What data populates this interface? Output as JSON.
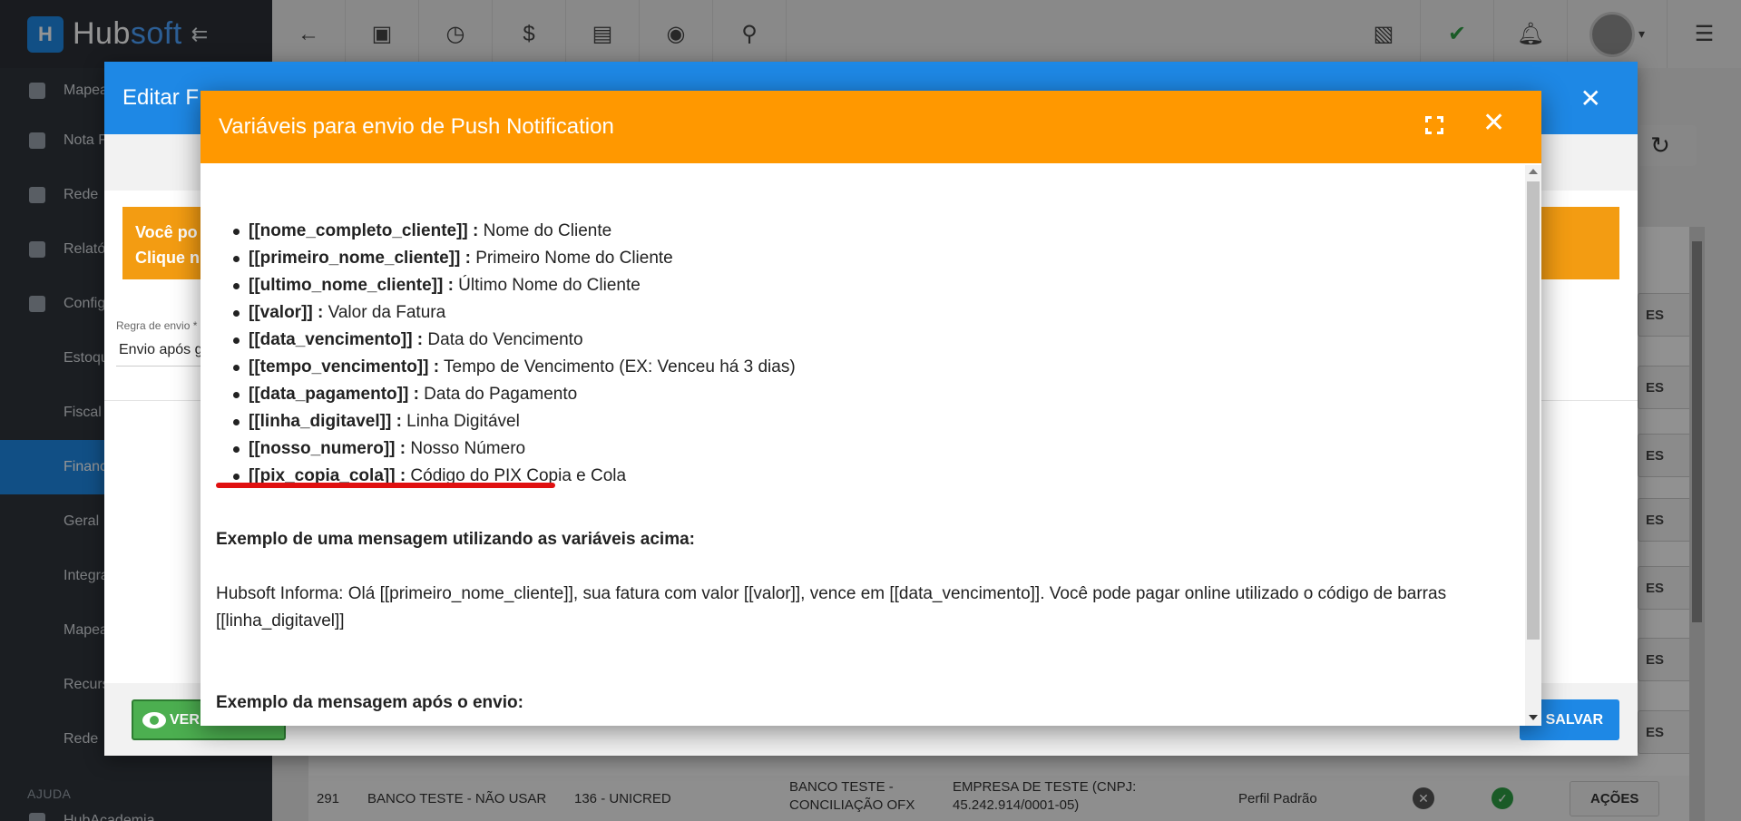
{
  "sidebar": {
    "logo_text_a": "Hub",
    "logo_text_b": "soft",
    "items": [
      {
        "label": "Mapea"
      },
      {
        "label": "Nota F"
      },
      {
        "label": "Rede"
      },
      {
        "label": "Relató"
      },
      {
        "label": "Config"
      }
    ],
    "sub_items": [
      {
        "label": "Estoqu"
      },
      {
        "label": "Fiscal"
      },
      {
        "label": "Financ"
      },
      {
        "label": "Geral"
      },
      {
        "label": "Integra"
      },
      {
        "label": "Mapea"
      },
      {
        "label": "Recurs"
      },
      {
        "label": "Rede"
      }
    ],
    "section_label": "AJUDA",
    "footer_item": "HubAcademia"
  },
  "background_table": {
    "row": {
      "id": "291",
      "name": "BANCO TESTE - NÃO USAR",
      "bank": "136 - UNICRED",
      "account": "BANCO TESTE - CONCILIAÇÃO OFX",
      "company": "EMPRESA DE TESTE (CNPJ: 45.242.914/0001-05)",
      "profile": "Perfil Padrão",
      "action": "AÇÕES"
    },
    "side_action_fragment": "ES"
  },
  "modal_edit": {
    "title": "Editar Forma de Cobrança",
    "title_visible": "Editar F",
    "warning_line1": "Você po",
    "warning_line2": "Clique n",
    "field_label": "Regra de envio *",
    "field_value": "Envio após g",
    "ver_button": "VER",
    "salvar_button": "SALVAR"
  },
  "modal_push": {
    "title": "Variáveis para envio de Push Notification",
    "variables": [
      {
        "key": "[[nome_completo_cliente]] :",
        "desc": " Nome do Cliente"
      },
      {
        "key": "[[primeiro_nome_cliente]] :",
        "desc": " Primeiro Nome do Cliente"
      },
      {
        "key": "[[ultimo_nome_cliente]] :",
        "desc": " Último Nome do Cliente"
      },
      {
        "key": "[[valor]] :",
        "desc": " Valor da Fatura"
      },
      {
        "key": "[[data_vencimento]] :",
        "desc": " Data do Vencimento"
      },
      {
        "key": "[[tempo_vencimento]] :",
        "desc": " Tempo de Vencimento (EX: Venceu há 3 dias)"
      },
      {
        "key": "[[data_pagamento]] :",
        "desc": " Data do Pagamento"
      },
      {
        "key": "[[linha_digitavel]] :",
        "desc": " Linha Digitável"
      },
      {
        "key": "[[nosso_numero]] :",
        "desc": " Nosso Número"
      },
      {
        "key": "[[pix_copia_cola]] :",
        "desc": " Código do PIX Copia e Cola"
      }
    ],
    "example_title": "Exemplo de uma mensagem utilizando as variáveis acima:",
    "example_text": "Hubsoft Informa: Olá [[primeiro_nome_cliente]], sua fatura com valor [[valor]], vence em [[data_vencimento]]. Você pode pagar online utilizado o código de barras [[linha_digitavel]]",
    "after_title": "Exemplo da mensagem após o envio:"
  },
  "colors": {
    "push_header": "#ff9800",
    "edit_header": "#1e88e5",
    "highlight_underline": "#e01010"
  }
}
